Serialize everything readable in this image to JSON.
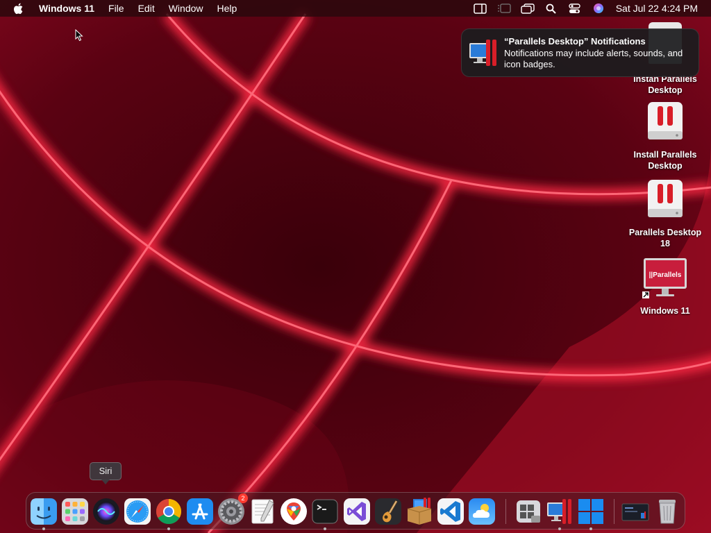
{
  "menubar": {
    "app_name": "Windows 11",
    "items": [
      "File",
      "Edit",
      "Window",
      "Help"
    ],
    "status_icons": [
      "sidebar-icon",
      "screen-mirroring-icon",
      "window-stack-icon",
      "spotlight-search-icon",
      "control-center-icon",
      "siri-icon"
    ],
    "clock": "Sat Jul 22  4:24 PM"
  },
  "notification": {
    "title": "“Parallels Desktop” Notifications",
    "body": "Notifications may include alerts, sounds, and icon badges."
  },
  "desktop": {
    "items": [
      {
        "label": "Instan Parallels Desktop",
        "icon": "parallels-installer-disk-icon"
      },
      {
        "label": "Install Parallels Desktop",
        "icon": "parallels-installer-disk-icon"
      },
      {
        "label": "Parallels Desktop 18",
        "icon": "parallels-installer-disk-icon"
      },
      {
        "label": "Windows 11",
        "icon": "parallels-vm-icon"
      }
    ]
  },
  "tooltip": {
    "label": "Siri"
  },
  "dock": {
    "apps": [
      {
        "name": "Finder",
        "running": true
      },
      {
        "name": "Launchpad",
        "running": false
      },
      {
        "name": "Siri",
        "running": false
      },
      {
        "name": "Safari",
        "running": false
      },
      {
        "name": "Google Chrome",
        "running": true
      },
      {
        "name": "App Store",
        "running": false
      },
      {
        "name": "System Settings",
        "running": false,
        "badge": "2"
      },
      {
        "name": "TextEdit",
        "running": false
      },
      {
        "name": "Google Maps",
        "running": false
      },
      {
        "name": "Terminal",
        "running": true
      },
      {
        "name": "Visual Studio",
        "running": false
      },
      {
        "name": "GarageBand",
        "running": false
      },
      {
        "name": "Installer",
        "running": false
      },
      {
        "name": "Visual Studio Code",
        "running": false
      },
      {
        "name": "Weather",
        "running": false
      },
      {
        "name": "Boot Camp Assistant",
        "running": false
      },
      {
        "name": "Parallels Desktop",
        "running": true
      },
      {
        "name": "Windows 11",
        "running": true
      },
      {
        "name": "Windows 11 Window",
        "running": false
      },
      {
        "name": "Trash",
        "running": false
      }
    ]
  },
  "colors": {
    "wallpaper_red": "#e0102a",
    "badge_red": "#ff3b30",
    "parallels_red": "#d81e28"
  }
}
